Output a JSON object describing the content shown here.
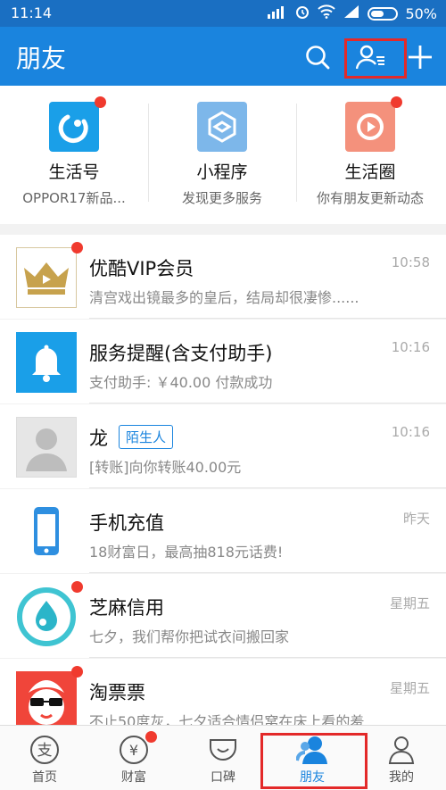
{
  "status": {
    "time": "11:14",
    "battery": "50%"
  },
  "header": {
    "title": "朋友"
  },
  "shortcuts": [
    {
      "name": "生活号",
      "sub": "OPPOR17新品...",
      "icon": "life-account-icon",
      "color": "#1a9fe8"
    },
    {
      "name": "小程序",
      "sub": "发现更多服务",
      "icon": "mini-program-icon",
      "color": "#7db7ea"
    },
    {
      "name": "生活圈",
      "sub": "你有朋友更新动态",
      "icon": "life-circle-icon",
      "color": "#f4917c"
    }
  ],
  "messages": [
    {
      "name": "优酷VIP会员",
      "msg": "清宫戏出镜最多的皇后，结局却很凄惨......",
      "time": "10:58"
    },
    {
      "name": "服务提醒(含支付助手)",
      "msg": "支付助手: ￥40.00 付款成功",
      "time": "10:16"
    },
    {
      "name": "龙",
      "tag": "陌生人",
      "msg": "[转账]向你转账40.00元",
      "time": "10:16"
    },
    {
      "name": "手机充值",
      "msg": "18财富日，最高抽818元话费!",
      "time": "昨天"
    },
    {
      "name": "芝麻信用",
      "msg": "七夕，我们帮你把试衣间搬回家",
      "time": "星期五"
    },
    {
      "name": "淘票票",
      "msg": "不止50度灰，七夕适合情侣窝在床上看的羞...",
      "time": "星期五"
    }
  ],
  "tabs": [
    {
      "label": "首页"
    },
    {
      "label": "财富"
    },
    {
      "label": "口碑"
    },
    {
      "label": "朋友"
    },
    {
      "label": "我的"
    }
  ],
  "colors": {
    "primary": "#1a84de",
    "statusbar": "#1a6fc2",
    "badge": "#f03a2e",
    "highlight": "#e32929"
  }
}
